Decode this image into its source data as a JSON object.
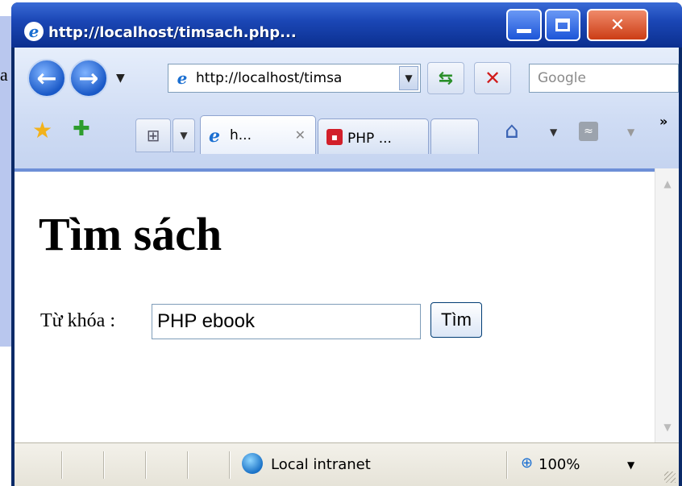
{
  "window": {
    "title": "http://localhost/timsach.php..."
  },
  "desktop": {
    "snippet": "a"
  },
  "toolbar": {
    "address_value": "http://localhost/timsa",
    "search_placeholder": "Google"
  },
  "tabs": [
    {
      "label": "h...",
      "active": true
    },
    {
      "label": "PHP ...",
      "active": false
    }
  ],
  "page": {
    "heading": "Tìm sách",
    "keyword_label": "Từ khóa :",
    "keyword_value": "PHP ebook",
    "submit_label": "Tìm"
  },
  "statusbar": {
    "zone": "Local intranet",
    "zoom": "100%"
  },
  "colors": {
    "titlebar": "#1b47b6",
    "content_border": "#6d8fd7",
    "desktop": "#b9c7ee"
  },
  "icons": [
    "ie-icon",
    "minimize-icon",
    "maximize-icon",
    "close-icon",
    "back-icon",
    "forward-icon",
    "refresh-icon",
    "stop-icon",
    "favorites-star-icon",
    "add-favorite-icon",
    "tab-list-icon",
    "home-icon",
    "feeds-icon",
    "zone-globe-icon",
    "zoom-icon"
  ]
}
